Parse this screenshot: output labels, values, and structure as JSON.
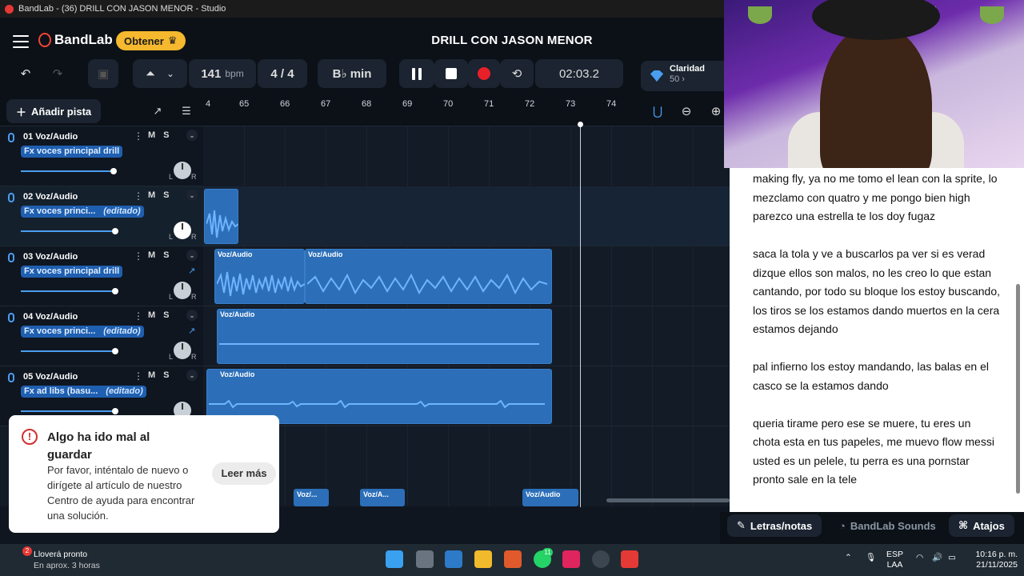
{
  "window": {
    "title": "BandLab - (36) DRILL CON JASON MENOR - Studio"
  },
  "header": {
    "brand": "BandLab",
    "upgrade_label": "Obtener",
    "project_title": "DRILL CON JASON MENOR"
  },
  "toolbar": {
    "tempo": "141",
    "tempo_unit": "bpm",
    "time_signature": "4 / 4",
    "key": "B♭ min",
    "time": "02:03.2",
    "clarity_label": "Claridad",
    "clarity_value": "50"
  },
  "subbar": {
    "add_track_label": "Añadir pista",
    "ruler": [
      "4",
      "65",
      "66",
      "67",
      "68",
      "69",
      "70",
      "71",
      "72",
      "73",
      "74"
    ]
  },
  "tracks": [
    {
      "name": "01  Voz/Audio",
      "fx": "Fx voces principal drill",
      "edited": "",
      "mute": "M",
      "solo": "S"
    },
    {
      "name": "02  Voz/Audio",
      "fx": "Fx voces princi...",
      "edited": "(editado)",
      "mute": "M",
      "solo": "S"
    },
    {
      "name": "03  Voz/Audio",
      "fx": "Fx voces principal drill",
      "edited": "",
      "mute": "M",
      "solo": "S"
    },
    {
      "name": "04  Voz/Audio",
      "fx": "Fx voces princi...",
      "edited": "(editado)",
      "mute": "M",
      "solo": "S"
    },
    {
      "name": "05  Voz/Audio",
      "fx": "Fx ad libs (basu...",
      "edited": "(editado)",
      "mute": "M",
      "solo": "S"
    }
  ],
  "clips": {
    "label": "Voz/Audio",
    "mini1": "Voz/...",
    "mini2": "Voz/A...",
    "mini3": "Voz/Audio"
  },
  "toast": {
    "title": "Algo ha ido mal al guardar",
    "body": "Por favor, inténtalo de nuevo o dirígete al artículo de nuestro Centro de ayuda para encontrar una solución.",
    "action": "Leer más"
  },
  "lyrics": [
    "making fly, ya no me tomo el lean con la sprite, lo mezclamo con quatro y me pongo bien high parezco una estrella te los doy fugaz",
    "saca la tola y ve a buscarlos pa ver si es verad dizque ellos son malos, no les creo lo que estan cantando, por todo su bloque los estoy buscando, los tiros se los estamos dando muertos en la cera estamos dejando",
    "pal infierno los estoy mandando, las balas en el casco se la estamos dando",
    "queria tirame pero ese se muere, tu eres un chota esta en tus papeles, me muevo flow messi usted es un pelele, tu perra es una pornstar pronto sale en la tele"
  ],
  "panel_tabs": {
    "lyrics": "Letras/notas",
    "sounds": "BandLab Sounds",
    "shortcuts": "Atajos"
  },
  "taskbar": {
    "weather_badge": "2",
    "weather_title": "Lloverá pronto",
    "weather_sub": "En aprox. 3 horas",
    "whatsapp_badge": "11",
    "lang": "ESP",
    "region": "LAA",
    "time": "10:16 p. m.",
    "date": "21/11/2025"
  },
  "colors": {
    "accent": "#4b9df0",
    "clip": "#2c6fb8",
    "record": "#e8202a",
    "upgrade": "#f5b82e"
  }
}
